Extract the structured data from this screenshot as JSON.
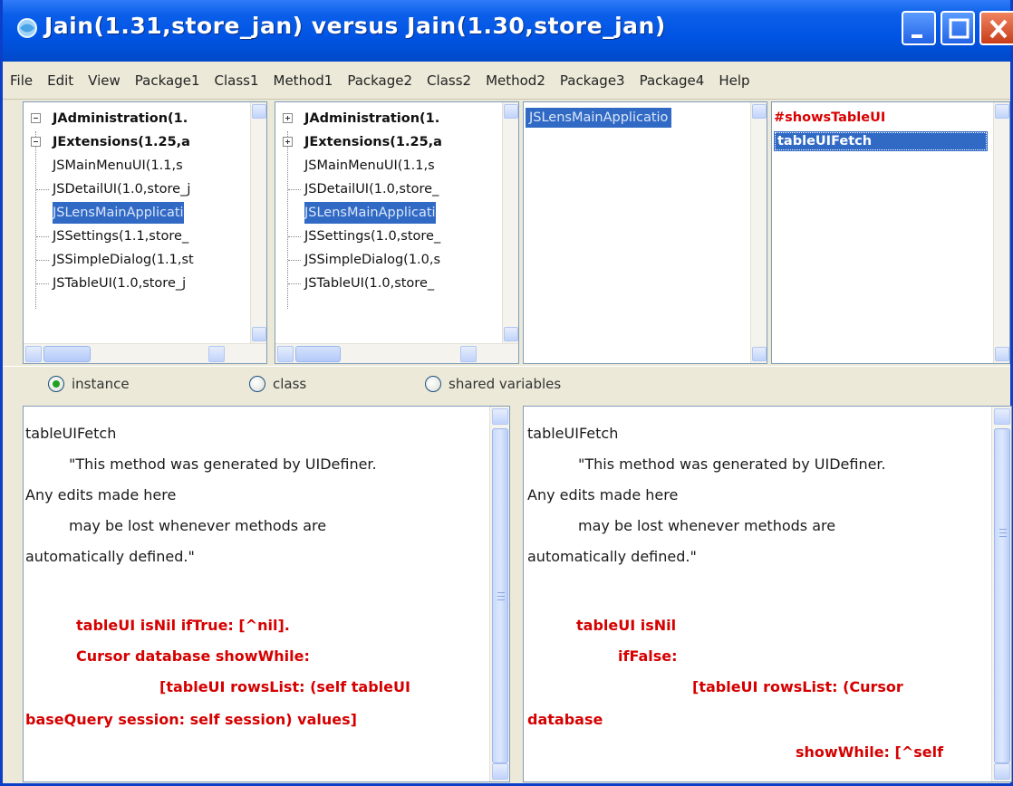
{
  "window": {
    "title": "Jain(1.31,store_jan) versus Jain(1.30,store_jan)"
  },
  "menu": [
    "File",
    "Edit",
    "View",
    "Package1",
    "Class1",
    "Method1",
    "Package2",
    "Class2",
    "Method2",
    "Package3",
    "Package4",
    "Help"
  ],
  "left_tree": {
    "items": [
      {
        "label": "JAdministration(1.",
        "bold": true,
        "expander": "minus"
      },
      {
        "label": "JExtensions(1.25,a",
        "bold": true,
        "expander": "minus"
      },
      {
        "label": "JSMainMenuUI(1.1,s",
        "bold": false
      },
      {
        "label": "JSDetailUI(1.0,store_j",
        "bold": false
      },
      {
        "label": "JSLensMainApplicati",
        "bold": false,
        "selected": true
      },
      {
        "label": "JSSettings(1.1,store_",
        "bold": false
      },
      {
        "label": "JSSimpleDialog(1.1,st",
        "bold": false
      },
      {
        "label": "JSTableUI(1.0,store_j",
        "bold": false
      }
    ]
  },
  "right_tree": {
    "items": [
      {
        "label": "JAdministration(1.",
        "bold": true,
        "expander": "plus"
      },
      {
        "label": "JExtensions(1.25,a",
        "bold": true,
        "expander": "plus"
      },
      {
        "label": "JSMainMenuUI(1.1,s",
        "bold": false
      },
      {
        "label": "JSDetailUI(1.0,store_",
        "bold": false
      },
      {
        "label": "JSLensMainApplicati",
        "bold": false,
        "selected": true
      },
      {
        "label": "JSSettings(1.0,store_",
        "bold": false
      },
      {
        "label": "JSSimpleDialog(1.0,s",
        "bold": false
      },
      {
        "label": "JSTableUI(1.0,store_",
        "bold": false
      }
    ]
  },
  "class_list": {
    "items": [
      "JSLensMainApplicatio"
    ]
  },
  "method_list": {
    "items": [
      "#showsTableUI",
      "tableUIFetch"
    ]
  },
  "radio": {
    "options": [
      "instance",
      "class",
      "shared variables"
    ],
    "selected": "instance"
  },
  "code_left": {
    "lines": [
      {
        "text": "tableUIFetch",
        "red": false
      },
      {
        "text": "\"This method was generated by UIDefiner.",
        "red": false
      },
      {
        "text": "Any edits made here",
        "red": false
      },
      {
        "text": "may be lost whenever methods are",
        "red": false
      },
      {
        "text": "automatically defined.\"",
        "red": false
      },
      {
        "text": "tableUI isNil ifTrue: [^nil].",
        "red": true
      },
      {
        "text": "Cursor database showWhile:",
        "red": true
      },
      {
        "text": "[tableUI rowsList: (self tableUI",
        "red": true
      },
      {
        "text": "baseQuery session: self session) values]",
        "red": true
      }
    ]
  },
  "code_right": {
    "lines": [
      {
        "text": "tableUIFetch",
        "red": false
      },
      {
        "text": "\"This method was generated by UIDefiner.",
        "red": false
      },
      {
        "text": "Any edits made here",
        "red": false
      },
      {
        "text": "may be lost whenever methods are",
        "red": false
      },
      {
        "text": "automatically defined.\"",
        "red": false
      },
      {
        "text": "tableUI isNil",
        "red": true
      },
      {
        "text": "ifFalse:",
        "red": true
      },
      {
        "text": "[tableUI rowsList: (Cursor",
        "red": true
      },
      {
        "text": "database",
        "red": true
      },
      {
        "text": "showWhile: [^self",
        "red": true
      }
    ]
  }
}
